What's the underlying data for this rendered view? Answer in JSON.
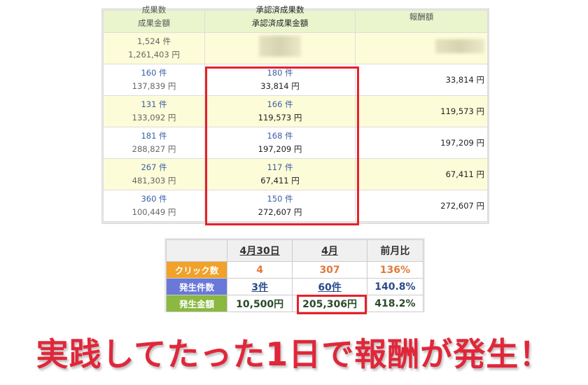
{
  "results_table": {
    "headers": [
      {
        "line1": "成果数",
        "line2": "成果金額"
      },
      {
        "line1": "承認済成果数",
        "line2": "承認済成果金額"
      },
      {
        "line1": "報酬額"
      }
    ],
    "total": {
      "count": "1,524 件",
      "amount": "1,261,403 円"
    },
    "rows": [
      {
        "count": "160 件",
        "amount": "137,839 円",
        "approved_count": "180 件",
        "approved_amount": "33,814 円",
        "reward": "33,814 円"
      },
      {
        "count": "131 件",
        "amount": "133,092 円",
        "approved_count": "166 件",
        "approved_amount": "119,573 円",
        "reward": "119,573 円"
      },
      {
        "count": "181 件",
        "amount": "288,827 円",
        "approved_count": "168 件",
        "approved_amount": "197,209 円",
        "reward": "197,209 円"
      },
      {
        "count": "267 件",
        "amount": "481,303 円",
        "approved_count": "117 件",
        "approved_amount": "67,411 円",
        "reward": "67,411 円"
      },
      {
        "count": "360 件",
        "amount": "100,449 円",
        "approved_count": "150 件",
        "approved_amount": "272,607 円",
        "reward": "272,607 円"
      }
    ]
  },
  "summary_table": {
    "headers": [
      "4月30日",
      "4月",
      "前月比"
    ],
    "rows": [
      {
        "label": "クリック数",
        "label_color": "#f0a22a",
        "value_color": "#e07a3a",
        "day": "4",
        "month": "307",
        "ratio": "136%"
      },
      {
        "label": "発生件数",
        "label_color": "#6a78d8",
        "value_color": "#2a4a8a",
        "day": "3件",
        "month": "60件",
        "ratio": "140.8%"
      },
      {
        "label": "発生金額",
        "label_color": "#8ab840",
        "value_color": "#2a4a2a",
        "day": "10,500円",
        "month": "205,306円",
        "ratio": "418.2%"
      }
    ]
  },
  "headline": "実践してたった1日で報酬が発生！"
}
